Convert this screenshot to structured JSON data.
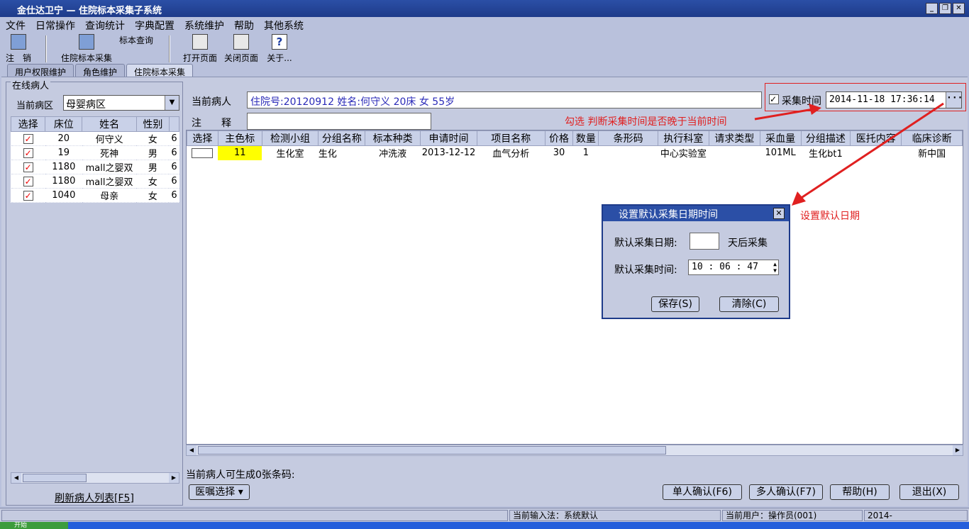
{
  "window": {
    "title": "金仕达卫宁 — 住院标本采集子系统"
  },
  "menu": [
    "文件",
    "日常操作",
    "查询统计",
    "字典配置",
    "系统维护",
    "帮助",
    "其他系统"
  ],
  "toolbar": {
    "logout": "注　销",
    "collect": "住院标本采集",
    "query": "标本查询",
    "open_page": "打开页面",
    "close_page": "关闭页面",
    "about": "关于..."
  },
  "tabs": [
    "用户权限维护",
    "角色维护",
    "住院标本采集"
  ],
  "left": {
    "legend": "在线病人",
    "ward_label": "当前病区",
    "ward_value": "母婴病区",
    "columns": [
      "选择",
      "床位",
      "姓名",
      "性别"
    ],
    "rows": [
      {
        "checked": "✓",
        "bed": "20",
        "name": "何守义",
        "sex": "女",
        "more": "6"
      },
      {
        "checked": "✓",
        "bed": "19",
        "name": "死神",
        "sex": "男",
        "more": "6"
      },
      {
        "checked": "✓",
        "bed": "1180",
        "name": "mall之婴双",
        "sex": "男",
        "more": "6"
      },
      {
        "checked": "✓",
        "bed": "1180",
        "name": "mall之婴双",
        "sex": "女",
        "more": "6"
      },
      {
        "checked": "✓",
        "bed": "1040",
        "name": "母亲",
        "sex": "女",
        "more": "6"
      }
    ],
    "refresh": "刷新病人列表[F5]"
  },
  "right": {
    "patient_label": "当前病人",
    "patient_info": "住院号:20120912 姓名:何守义 20床 女 55岁",
    "note_label": "注　　释",
    "note_value": "",
    "collect_time_label": "采集时间",
    "collect_time_check": "✓",
    "collect_time_value": "2014-11-18 17:36:14",
    "columns": [
      "选择",
      "主色标",
      "检测小组",
      "分组名称",
      "标本种类",
      "申请时间",
      "项目名称",
      "价格",
      "数量",
      "条形码",
      "执行科室",
      "请求类型",
      "采血量",
      "分组描述",
      "医托内容",
      "临床诊断"
    ],
    "row": [
      "",
      "11",
      "生化室",
      "生化",
      "冲洗液",
      "2013-12-12",
      "血气分析",
      "30",
      "1",
      "",
      "中心实验室",
      "",
      "101ML",
      "生化bt1",
      "",
      "新中国"
    ],
    "gen_label": "当前病人可生成0张条码:",
    "order_select": "医嘱选择",
    "btn_single": "单人确认(F6)",
    "btn_multi": "多人确认(F7)",
    "btn_help": "帮助(H)",
    "btn_exit": "退出(X)"
  },
  "annotations": {
    "a1": "勾选 判断采集时间是否晚于当前时间",
    "a2": "设置默认日期"
  },
  "dialog": {
    "title": "设置默认采集日期时间",
    "date_label": "默认采集日期:",
    "date_value": "",
    "date_suffix": "天后采集",
    "time_label": "默认采集时间:",
    "time_value": "10 : 06 : 47",
    "save": "保存(S)",
    "clear": "清除(C)"
  },
  "status": {
    "ime": "当前输入法：系统默认",
    "user": "当前用户：操作员(001)",
    "date": "2014-"
  },
  "taskbar": {
    "start": "开始"
  },
  "colors": {
    "title": "#2b4fa6",
    "annotation": "#e02020",
    "highlight": "#ffff00",
    "check": "#e00000"
  }
}
